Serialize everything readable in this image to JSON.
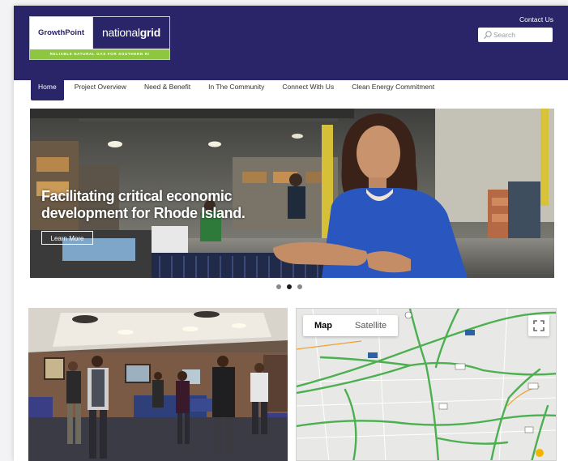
{
  "header": {
    "logo": {
      "left": "GrowthPoint",
      "right_prefix": "national",
      "right_bold": "grid",
      "tagline": "RELIABLE NATURAL GAS FOR SOUTHERN RI"
    },
    "contact_link": "Contact Us",
    "search_placeholder": "Search"
  },
  "nav": {
    "items": [
      {
        "label": "Home",
        "active": true
      },
      {
        "label": "Project Overview"
      },
      {
        "label": "Need & Benefit"
      },
      {
        "label": "In The Community"
      },
      {
        "label": "Connect With Us"
      },
      {
        "label": "Clean Energy Commitment"
      }
    ]
  },
  "hero": {
    "headline": "Facilitating critical economic development for Rhode Island.",
    "button": "Learn More",
    "slides": 3,
    "active_slide": 2
  },
  "map": {
    "tabs": [
      "Map",
      "Satellite"
    ],
    "active_tab": "Map"
  },
  "colors": {
    "header_bg": "#2a2468",
    "accent_green": "#8dc63f",
    "road_green": "#4caf50"
  }
}
